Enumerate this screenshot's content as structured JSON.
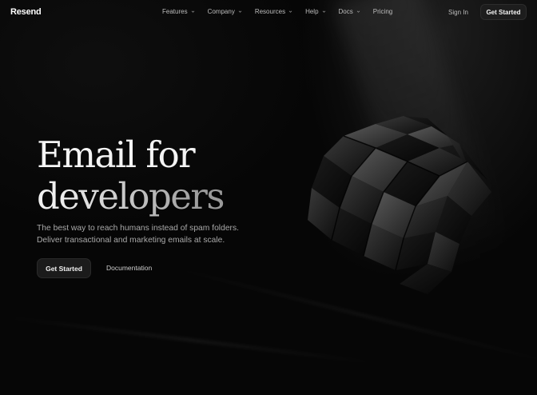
{
  "nav": {
    "logo": "Resend",
    "items": [
      {
        "label": "Features",
        "has_dropdown": true
      },
      {
        "label": "Company",
        "has_dropdown": true
      },
      {
        "label": "Resources",
        "has_dropdown": true
      },
      {
        "label": "Help",
        "has_dropdown": true
      },
      {
        "label": "Docs",
        "has_dropdown": true
      },
      {
        "label": "Pricing",
        "has_dropdown": false
      }
    ],
    "sign_in": "Sign In",
    "cta": "Get Started"
  },
  "hero": {
    "title_line1": "Email for",
    "title_line2": "developers",
    "subtitle_line1": "The best way to reach humans instead of spam folders.",
    "subtitle_line2": "Deliver transactional and marketing emails at scale.",
    "primary_button": "Get Started",
    "secondary_button": "Documentation"
  },
  "colors": {
    "background": "#050505",
    "text": "#f4f4f4",
    "muted": "#a9a9a9",
    "button_bg": "#1b1b1b"
  },
  "icons": [
    "chevron-down-icon",
    "rubiks-cube-illustration"
  ]
}
